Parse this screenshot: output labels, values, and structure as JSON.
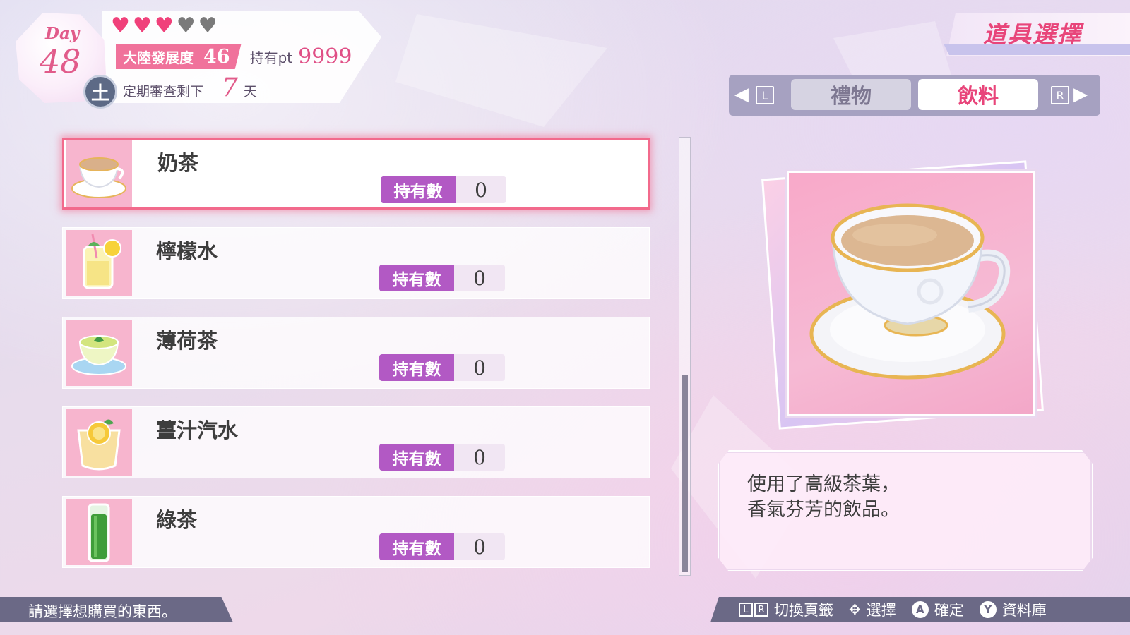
{
  "status": {
    "day_label": "Day",
    "day_number": "48",
    "weekday": "土",
    "hearts_filled": 3,
    "hearts_total": 5,
    "development_label": "大陸發展度",
    "development_value": "46",
    "points_label": "持有pt",
    "points_value": "9999",
    "review_label": "定期審查剩下",
    "review_days": "7",
    "review_unit": "天"
  },
  "header": {
    "title": "道具選擇"
  },
  "tabs": {
    "left_key": "L",
    "right_key": "R",
    "items": [
      {
        "label": "禮物",
        "active": false
      },
      {
        "label": "飲料",
        "active": true
      }
    ]
  },
  "items": [
    {
      "name": "奶茶",
      "qty_label": "持有數",
      "qty": "0",
      "selected": true,
      "icon": "milk-tea-icon"
    },
    {
      "name": "檸檬水",
      "qty_label": "持有數",
      "qty": "0",
      "selected": false,
      "icon": "lemonade-icon"
    },
    {
      "name": "薄荷茶",
      "qty_label": "持有數",
      "qty": "0",
      "selected": false,
      "icon": "mint-tea-icon"
    },
    {
      "name": "薑汁汽水",
      "qty_label": "持有數",
      "qty": "0",
      "selected": false,
      "icon": "ginger-soda-icon"
    },
    {
      "name": "綠茶",
      "qty_label": "持有數",
      "qty": "0",
      "selected": false,
      "icon": "green-tea-icon"
    }
  ],
  "description": {
    "line1": "使用了高級茶葉，",
    "line2": "香氣芬芳的飲品。"
  },
  "footer": {
    "prompt": "請選擇想購買的東西。",
    "controls": [
      {
        "keys": [
          "L",
          "R"
        ],
        "label": "切換頁籤"
      },
      {
        "button": "dpad",
        "label": "選擇"
      },
      {
        "button": "A",
        "label": "確定"
      },
      {
        "button": "Y",
        "label": "資料庫"
      }
    ]
  },
  "colors": {
    "accent": "#e8457a",
    "qty_label_bg": "#b259c4",
    "footer_bg": "#6b6986"
  }
}
